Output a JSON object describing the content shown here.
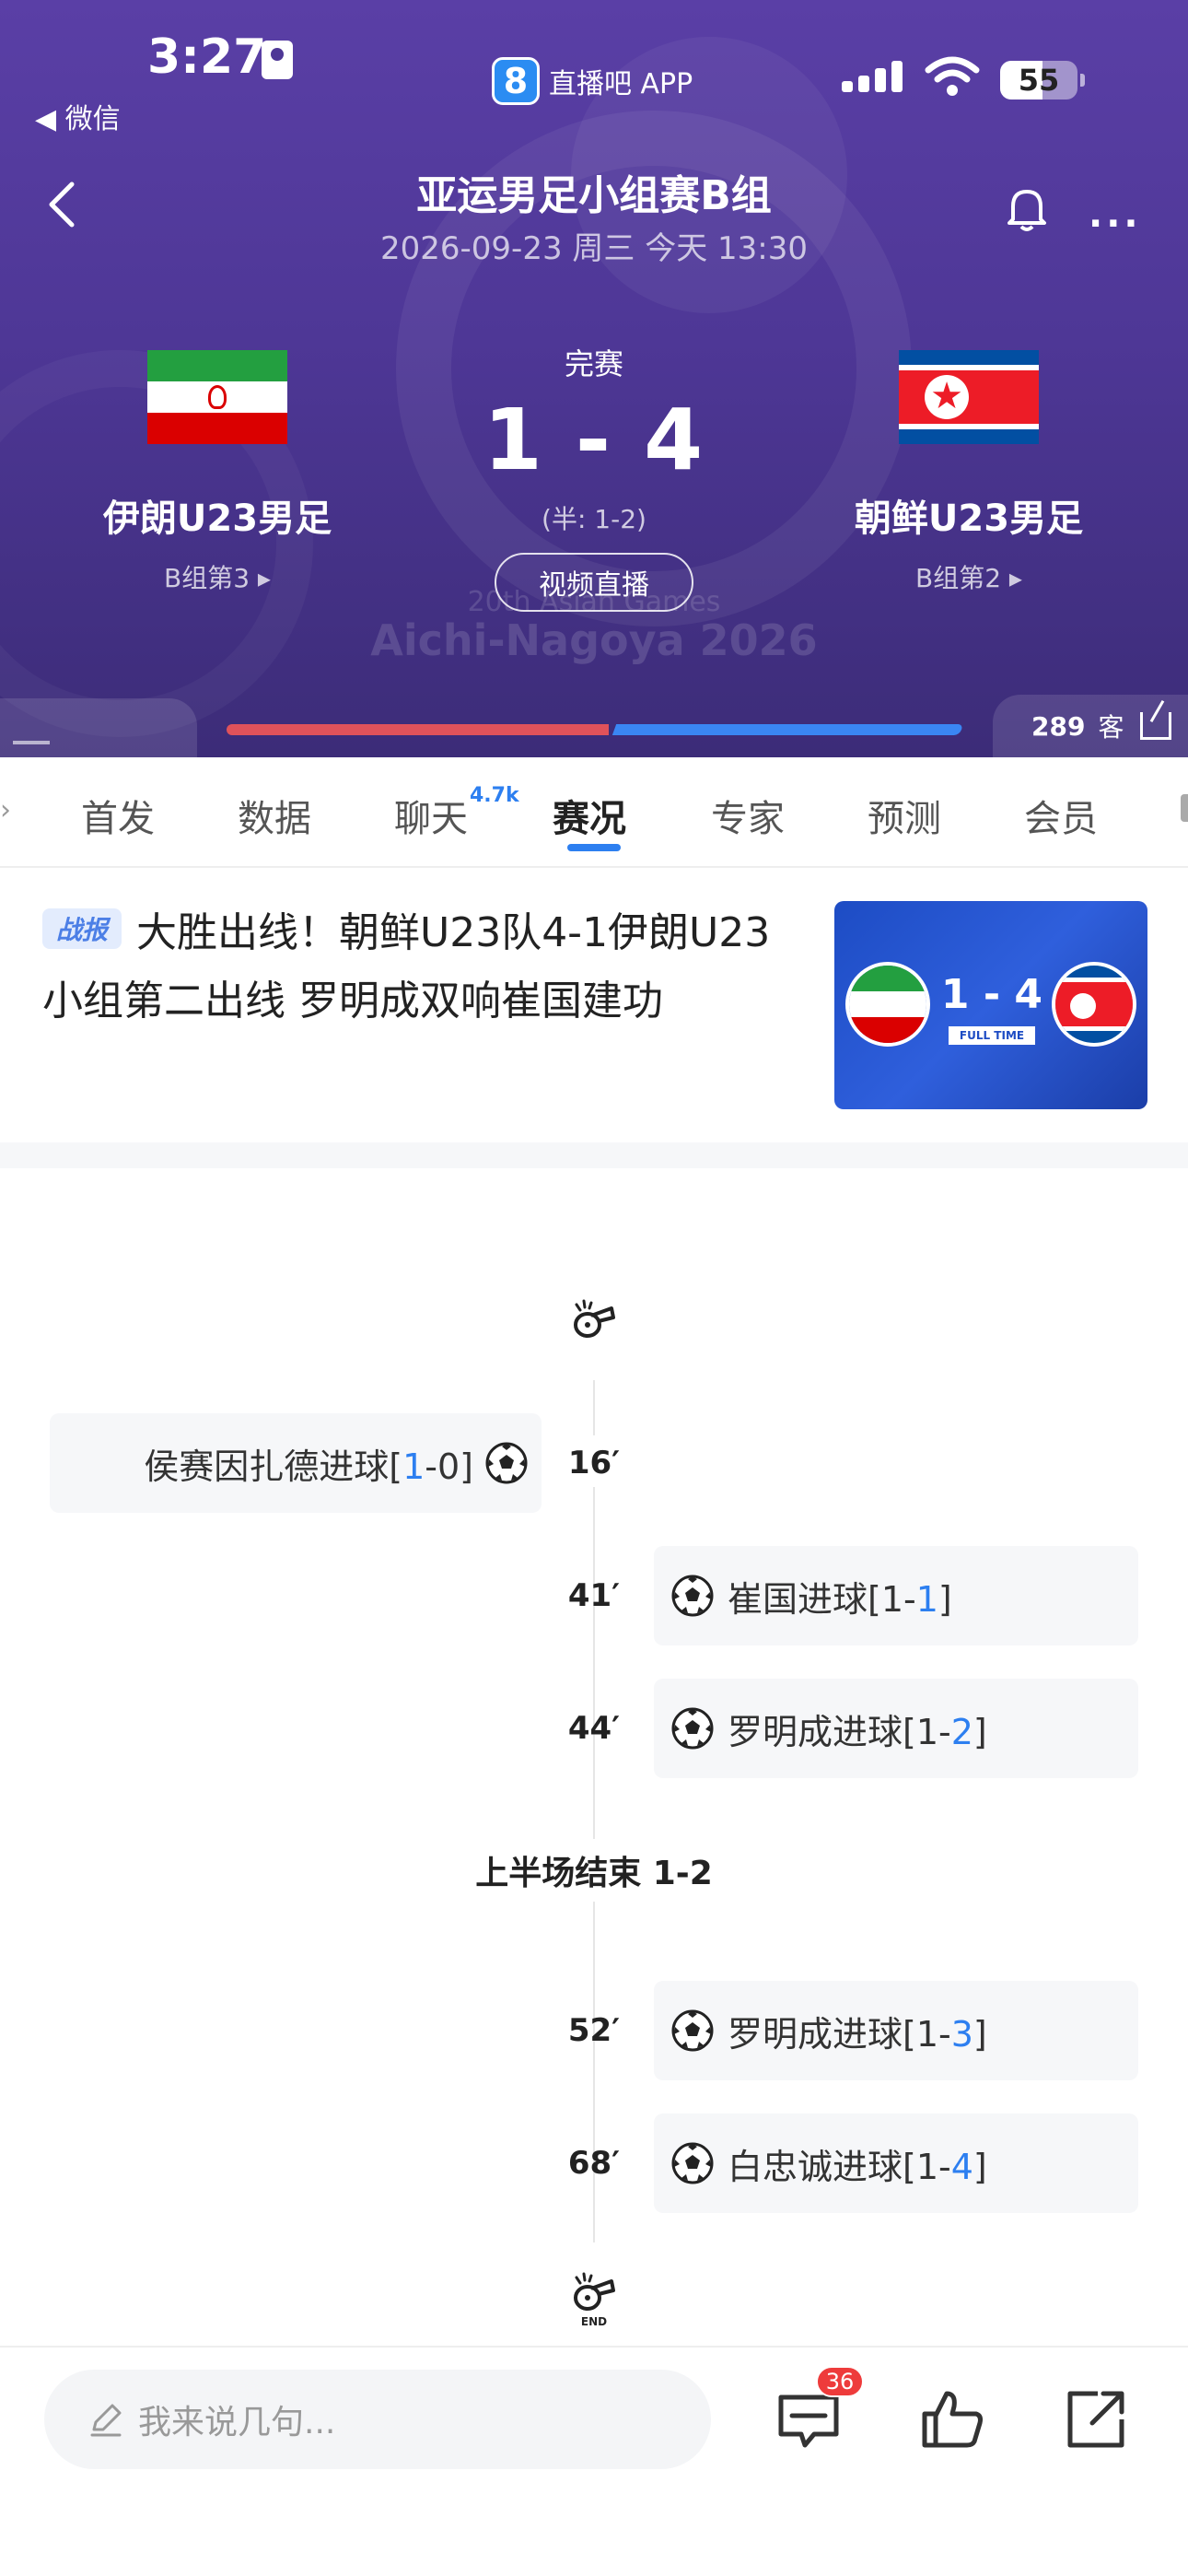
{
  "status_bar": {
    "time": "3:27",
    "back_app": "微信",
    "app_name": "直播吧 APP",
    "app_logo": "8",
    "battery": "55"
  },
  "header": {
    "title": "亚运男足小组赛B组",
    "subtitle": "2026-09-23 周三 今天 13:30",
    "watermark_line1": "20th Asian Games",
    "watermark_line2": "Aichi-Nagoya 2026"
  },
  "match": {
    "status": "完赛",
    "score": "1 - 4",
    "half_score": "(半: 1-2)",
    "live_button": "视频直播",
    "home": {
      "name": "伊朗U23男足",
      "rank": "B组第3 ▸",
      "flag": "iran-flag"
    },
    "away": {
      "name": "朝鲜U23男足",
      "rank": "B组第2 ▸",
      "flag": "north-korea-flag"
    }
  },
  "possession_bar": {
    "home_fraction": 0.52,
    "viewers": "289",
    "viewers_label": "客"
  },
  "tabs": [
    {
      "label": "首发",
      "badge": ""
    },
    {
      "label": "数据",
      "badge": ""
    },
    {
      "label": "聊天",
      "badge": "4.7k"
    },
    {
      "label": "赛况",
      "badge": ""
    },
    {
      "label": "专家",
      "badge": ""
    },
    {
      "label": "预测",
      "badge": ""
    },
    {
      "label": "会员",
      "badge": ""
    }
  ],
  "active_tab": "赛况",
  "news": {
    "tag": "战报",
    "headline": "大胜出线！朝鲜U23队4-1伊朗U23小组第二出线 罗明成双响崔国建功",
    "thumb_score": "1 - 4",
    "thumb_label": "FULL TIME"
  },
  "timeline": {
    "events": [
      {
        "minute": "16′",
        "side": "home",
        "text_before": "侯赛因扎德进球[",
        "home_goals": "1",
        "sep": "-",
        "away_goals": "0",
        "text_after": "]",
        "highlight": "home"
      },
      {
        "minute": "41′",
        "side": "away",
        "text_before": "崔国进球[",
        "home_goals": "1",
        "sep": "-",
        "away_goals": "1",
        "text_after": "]",
        "highlight": "away"
      },
      {
        "minute": "44′",
        "side": "away",
        "text_before": "罗明成进球[",
        "home_goals": "1",
        "sep": "-",
        "away_goals": "2",
        "text_after": "]",
        "highlight": "away"
      },
      {
        "minute": "52′",
        "side": "away",
        "text_before": "罗明成进球[",
        "home_goals": "1",
        "sep": "-",
        "away_goals": "3",
        "text_after": "]",
        "highlight": "away"
      },
      {
        "minute": "68′",
        "side": "away",
        "text_before": "白忠诚进球[",
        "home_goals": "1",
        "sep": "-",
        "away_goals": "4",
        "text_after": "]",
        "highlight": "away"
      }
    ],
    "halftime": "上半场结束 1-2",
    "end_label": "END"
  },
  "bottom_bar": {
    "comment_placeholder": "我来说几句...",
    "comment_count": "36"
  },
  "colors": {
    "hero": "#4e3796",
    "accent": "#2d7ff0",
    "home_bar": "#e0525a",
    "away_bar": "#3a86f3",
    "badge": "#ee3b3b"
  }
}
